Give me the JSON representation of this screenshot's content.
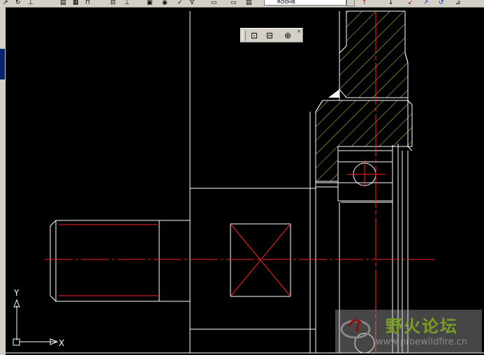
{
  "toolbar": {
    "layer_combo_value": "ROOHB",
    "icons": [
      "offset-icon",
      "rotate-icon",
      "dimension-icon",
      "hatch-icon",
      "table-icon",
      "insert-icon",
      "export-icon",
      "properties-icon",
      "check-icon",
      "pan-icon",
      "block-icon",
      "print-icon",
      "text-icon"
    ]
  },
  "floating_toolbar": {
    "buttons": [
      "zoom-window-icon",
      "zoom-previous-icon",
      "orbit-icon"
    ]
  },
  "ucs": {
    "x_label": "X",
    "y_label": "Y"
  },
  "watermark": {
    "title": "野火论坛",
    "url": "www.proewildfire.cn"
  },
  "colors": {
    "background": "#000000",
    "geometry": "#ffffff",
    "centerline": "#ff2020",
    "hatch": "#e0e040",
    "ui_gray": "#d4d0c8"
  }
}
